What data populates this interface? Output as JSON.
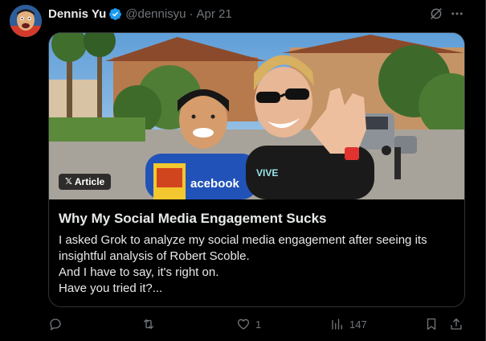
{
  "post": {
    "author_name": "Dennis Yu",
    "handle": "@dennisyu",
    "separator": "·",
    "date": "Apr 21",
    "header_icons": [
      "grok-icon",
      "more-icon"
    ]
  },
  "card": {
    "badge_label": "Article",
    "image_shirt_text": "acebook",
    "title": "Why My Social Media Engagement Sucks",
    "body_lines": [
      "I asked Grok to analyze my social media engagement after seeing its",
      "insightful analysis of Robert Scoble.",
      "And I have to say, it's right on.",
      "Have you tried it?..."
    ]
  },
  "actions": {
    "reply_icon": "reply-icon",
    "repost_icon": "repost-icon",
    "like_icon": "like-icon",
    "like_count": "1",
    "views_icon": "views-icon",
    "views_count": "147",
    "bookmark_icon": "bookmark-icon",
    "share_icon": "share-icon"
  },
  "colors": {
    "background": "#000000",
    "text_primary": "#e7e9ea",
    "text_secondary": "#71767b",
    "border": "#2f3336",
    "verified": "#1d9bf0"
  }
}
